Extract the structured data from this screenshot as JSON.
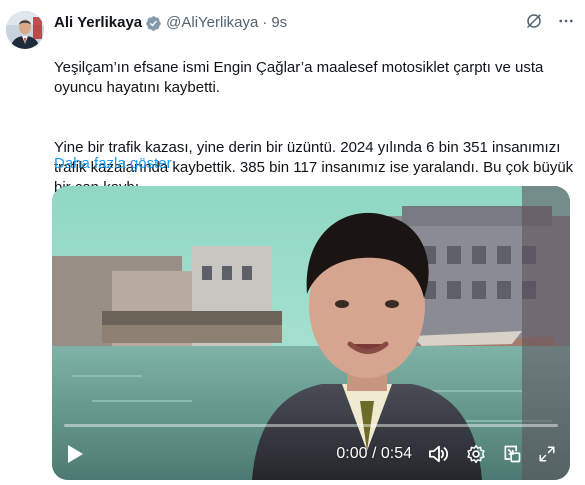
{
  "author": {
    "name": "Ali Yerlikaya",
    "handle": "@AliYerlikaya",
    "separator": "·",
    "time": "9s"
  },
  "tweet": {
    "paragraphs": [
      "Yeşilçam’ın efsane ismi Engin Çağlar’a maalesef motosiklet çarptı ve usta oyuncu hayatını kaybetti.",
      "Yine bir trafik kazası, yine derin bir üzüntü. 2024 yılında 6 bin 351 insanımızı trafik kazalarında kaybettik. 385 bin 117 insanımız ise yaralandı. Bu çok büyük bir can kaybı."
    ],
    "show_more_label": "Daha fazla göster"
  },
  "video": {
    "timecode": "0:00 / 0:54",
    "progress": 0
  },
  "icons": {
    "verified": "verified-badge-icon",
    "grok": "grok-icon",
    "more": "more-icon",
    "play": "play-icon",
    "volume": "volume-icon",
    "settings": "settings-icon",
    "pip": "picture-in-picture-icon",
    "fullscreen": "fullscreen-icon"
  },
  "colors": {
    "accent": "#1d9bf0",
    "text": "#0f1419",
    "secondary": "#536471"
  }
}
